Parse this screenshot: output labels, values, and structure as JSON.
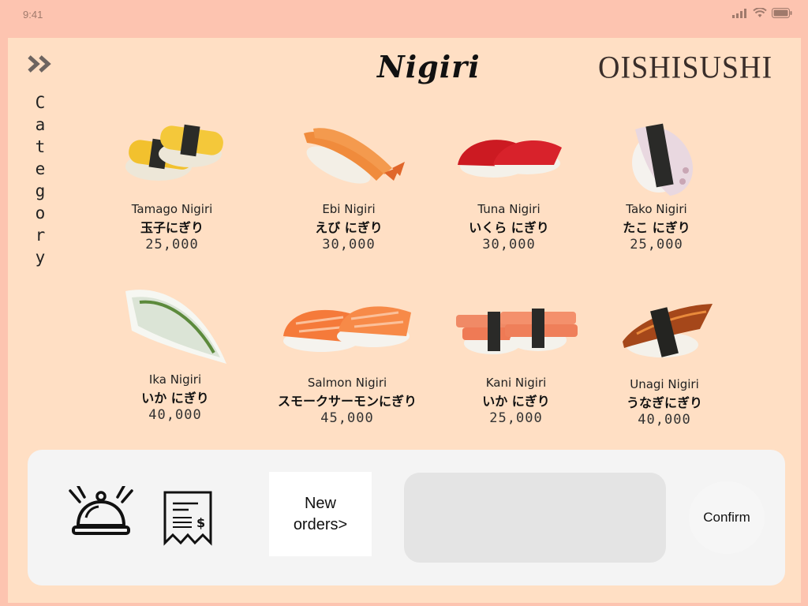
{
  "status_bar": {
    "time": "9:41"
  },
  "sidebar": {
    "category_label": "Category"
  },
  "header": {
    "title": "Nigiri",
    "brand": "OISHISUSHI"
  },
  "menu": {
    "items": [
      {
        "en": "Tamago Nigiri",
        "jp": "玉子にぎり",
        "price": "25,000"
      },
      {
        "en": "Ebi Nigiri",
        "jp": "えび にぎり",
        "price": "30,000"
      },
      {
        "en": "Tuna Nigiri",
        "jp": "いくら にぎり",
        "price": "30,000"
      },
      {
        "en": "Tako Nigiri",
        "jp": "たこ にぎり",
        "price": "25,000"
      },
      {
        "en": "Ika Nigiri",
        "jp": "いか にぎり",
        "price": "40,000"
      },
      {
        "en": "Salmon Nigiri",
        "jp": "スモークサーモンにぎり",
        "price": "45,000"
      },
      {
        "en": "Kani Nigiri",
        "jp": "いか にぎり",
        "price": "25,000"
      },
      {
        "en": "Unagi Nigiri",
        "jp": "うなぎにぎり",
        "price": "40,000"
      }
    ]
  },
  "bottom_bar": {
    "new_orders_label": "New\norders>",
    "confirm_label": "Confirm",
    "bell_icon": "service-bell-icon",
    "bill_icon": "receipt-icon"
  },
  "colors": {
    "background": "#fdc4b0",
    "screen": "#ffdfc4",
    "panel": "#f4f4f4",
    "order_box": "#e4e4e4"
  }
}
